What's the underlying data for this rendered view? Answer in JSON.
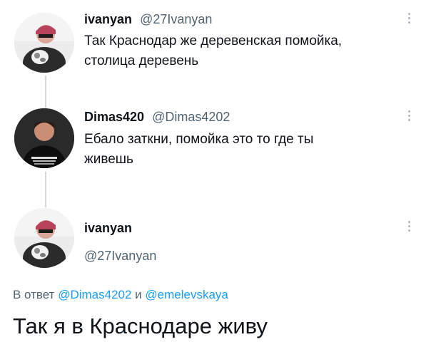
{
  "tweets": [
    {
      "name": "ivanyan",
      "handle": "@27Ivanyan",
      "text_line1": "Так Краснодар же деревенская помойка,",
      "text_line2": "столица деревень"
    },
    {
      "name": "Dimas420",
      "handle": "@Dimas4202",
      "text_line1": "Ебало заткни, помойка это то где ты",
      "text_line2": "живешь"
    }
  ],
  "main_tweet": {
    "name": "ivanyan",
    "handle": "@27Ivanyan",
    "reply_prefix": "В ответ",
    "reply_mention_1": "@Dimas4202",
    "reply_conjunction": "и",
    "reply_mention_2": "@emelevskaya",
    "text": "Так я в Краснодаре живу"
  },
  "icons": {
    "more": "more-vertical-icon"
  }
}
